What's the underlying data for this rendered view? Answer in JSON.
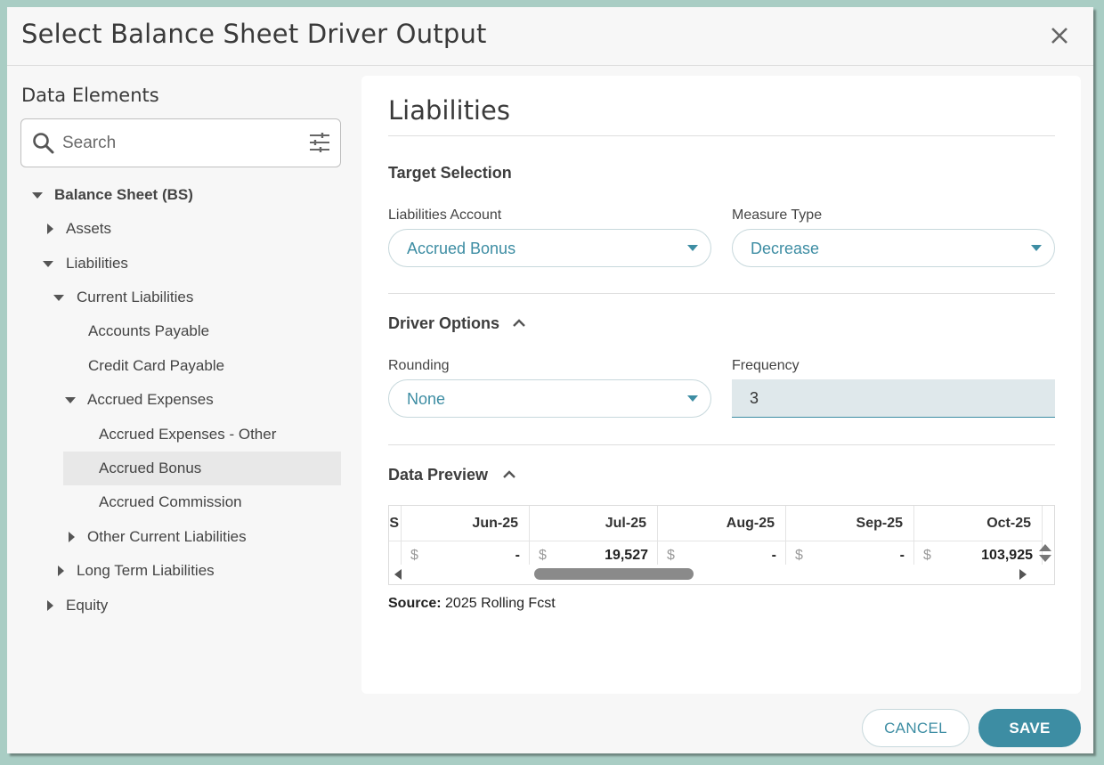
{
  "modal": {
    "title": "Select Balance Sheet Driver Output"
  },
  "left": {
    "title": "Data Elements",
    "search": {
      "placeholder": "Search",
      "value": ""
    },
    "tree": [
      {
        "label": "Balance Sheet (BS)",
        "expanded": true
      },
      {
        "label": "Assets",
        "expanded": false
      },
      {
        "label": "Liabilities",
        "expanded": true
      },
      {
        "label": "Current Liabilities",
        "expanded": true
      },
      {
        "label": "Accounts Payable"
      },
      {
        "label": "Credit Card Payable"
      },
      {
        "label": "Accrued Expenses",
        "expanded": true
      },
      {
        "label": "Accrued Expenses - Other"
      },
      {
        "label": "Accrued Bonus",
        "selected": true
      },
      {
        "label": "Accrued Commission"
      },
      {
        "label": "Other Current Liabilities",
        "expanded": false
      },
      {
        "label": "Long Term Liabilities",
        "expanded": false
      },
      {
        "label": "Equity",
        "expanded": false
      }
    ]
  },
  "content": {
    "title": "Liabilities",
    "target": {
      "heading": "Target Selection",
      "account_label": "Liabilities Account",
      "account_value": "Accrued Bonus",
      "measure_label": "Measure Type",
      "measure_value": "Decrease"
    },
    "driver": {
      "heading": "Driver Options",
      "rounding_label": "Rounding",
      "rounding_value": "None",
      "frequency_label": "Frequency",
      "frequency_value": "3"
    },
    "preview": {
      "heading": "Data Preview",
      "partial_head": "S",
      "columns": [
        {
          "month": "Jun-25",
          "currency": "$",
          "value": "-"
        },
        {
          "month": "Jul-25",
          "currency": "$",
          "value": "19,527"
        },
        {
          "month": "Aug-25",
          "currency": "$",
          "value": "-"
        },
        {
          "month": "Sep-25",
          "currency": "$",
          "value": "-"
        },
        {
          "month": "Oct-25",
          "currency": "$",
          "value": "103,925"
        }
      ],
      "source_label": "Source:",
      "source_value": "2025 Rolling Fcst"
    }
  },
  "buttons": {
    "cancel": "CANCEL",
    "save": "SAVE"
  },
  "colors": {
    "accent": "#3d8da3",
    "background": "#a9cdc4",
    "selected_row": "#e8e8e8"
  }
}
